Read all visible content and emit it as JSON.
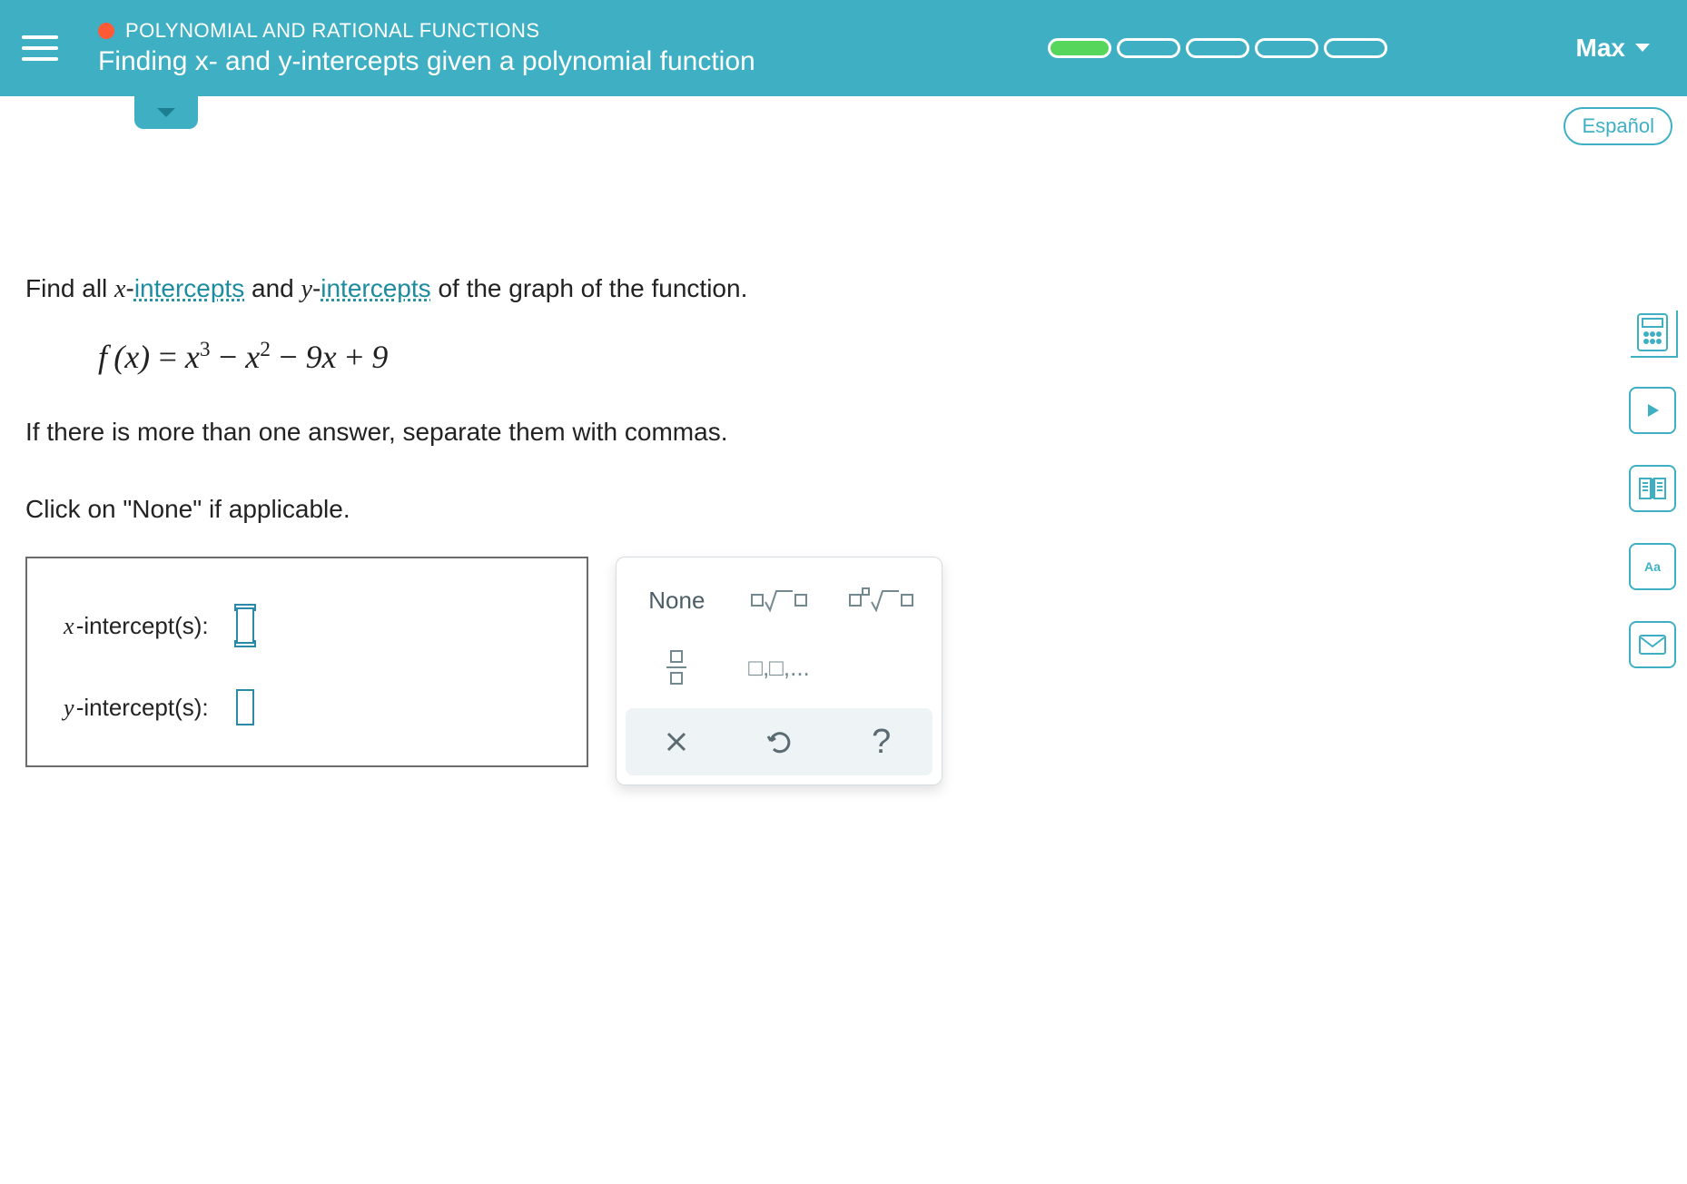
{
  "header": {
    "category": "POLYNOMIAL AND RATIONAL FUNCTIONS",
    "topic": "Finding x- and y-intercepts given a polynomial function",
    "user": "Max",
    "progress_segments": 5,
    "progress_filled": 1
  },
  "language_button": "Español",
  "question": {
    "line1_pre": "Find all ",
    "xint_var": "x",
    "xint_link": "intercepts",
    "mid": " and ",
    "yint_var": "y",
    "yint_link": "intercepts",
    "line1_post": " of the graph of the function.",
    "equation_text": "f(x) = x³ − x² − 9x + 9",
    "line2": "If there is more than one answer, separate them with commas.",
    "line3": "Click on \"None\" if applicable."
  },
  "answer_labels": {
    "x": "-intercept(s):",
    "y": "-intercept(s):"
  },
  "keypad": {
    "none": "None",
    "list": "□,□,...",
    "help": "?"
  },
  "side_labels": {
    "aa": "Aa"
  }
}
